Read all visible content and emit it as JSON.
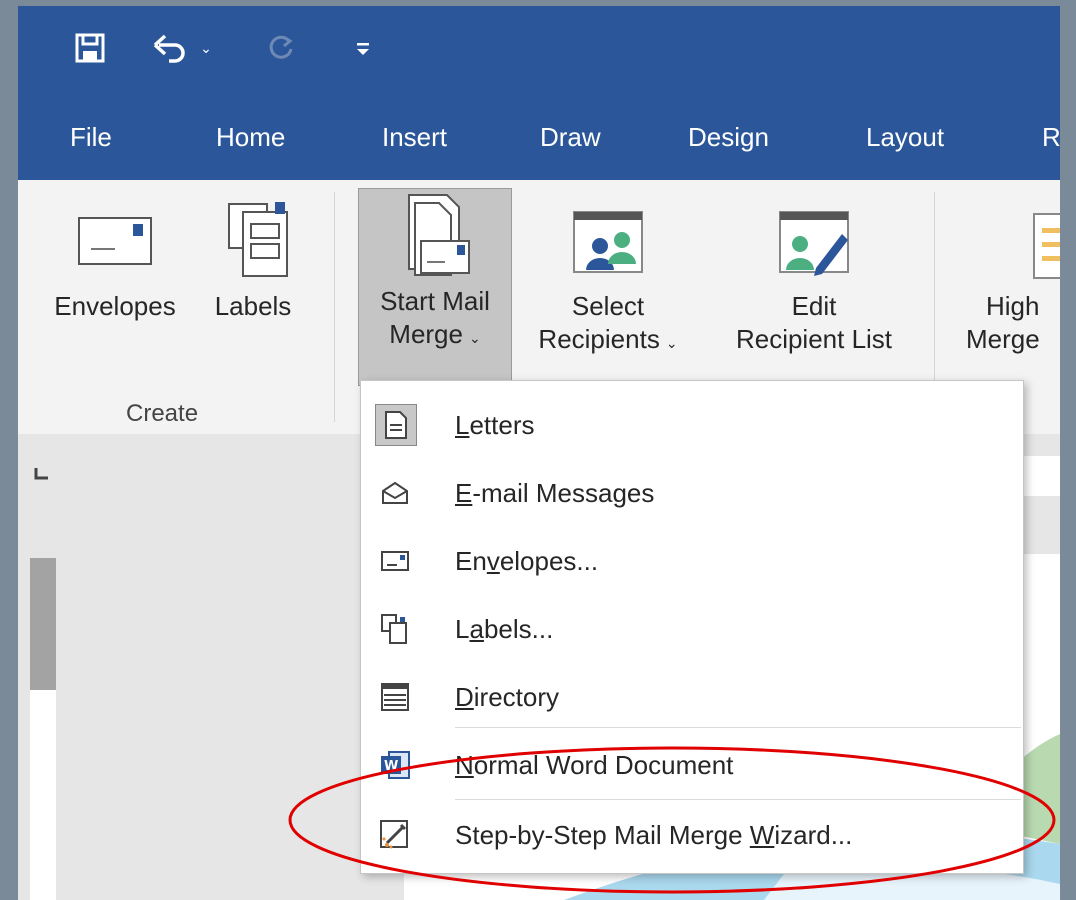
{
  "qat": {
    "save_icon": "save-icon",
    "undo_icon": "undo-icon",
    "redo_icon": "redo-icon",
    "customize_icon": "customize-qat-icon"
  },
  "tabs": [
    "File",
    "Home",
    "Insert",
    "Draw",
    "Design",
    "Layout",
    "R"
  ],
  "ribbon": {
    "envelopes": "Envelopes",
    "labels": "Labels",
    "create_group": "Create",
    "start_mail_line1": "Start Mail",
    "start_mail_line2": "Merge",
    "select_line1": "Select",
    "select_line2": "Recipients",
    "edit_line1": "Edit",
    "edit_line2": "Recipient List",
    "highlight_line1": "High",
    "highlight_line2": "Merge"
  },
  "menu": {
    "items": [
      {
        "pre": "",
        "ul": "L",
        "post": "etters",
        "icon": "letters-icon"
      },
      {
        "pre": "",
        "ul": "E",
        "post": "-mail Messages",
        "icon": "email-icon"
      },
      {
        "pre": "En",
        "ul": "v",
        "post": "elopes...",
        "icon": "envelope-icon"
      },
      {
        "pre": "L",
        "ul": "a",
        "post": "bels...",
        "icon": "labels-icon"
      },
      {
        "pre": "",
        "ul": "D",
        "post": "irectory",
        "icon": "directory-icon"
      },
      {
        "pre": "",
        "ul": "N",
        "post": "ormal Word Document",
        "icon": "word-icon"
      },
      {
        "pre": "Step-by-Step Mail Merge ",
        "ul": "W",
        "post": "izard...",
        "icon": "wizard-icon"
      }
    ]
  },
  "colors": {
    "accent": "#2b579a",
    "highlight": "#e00000"
  }
}
